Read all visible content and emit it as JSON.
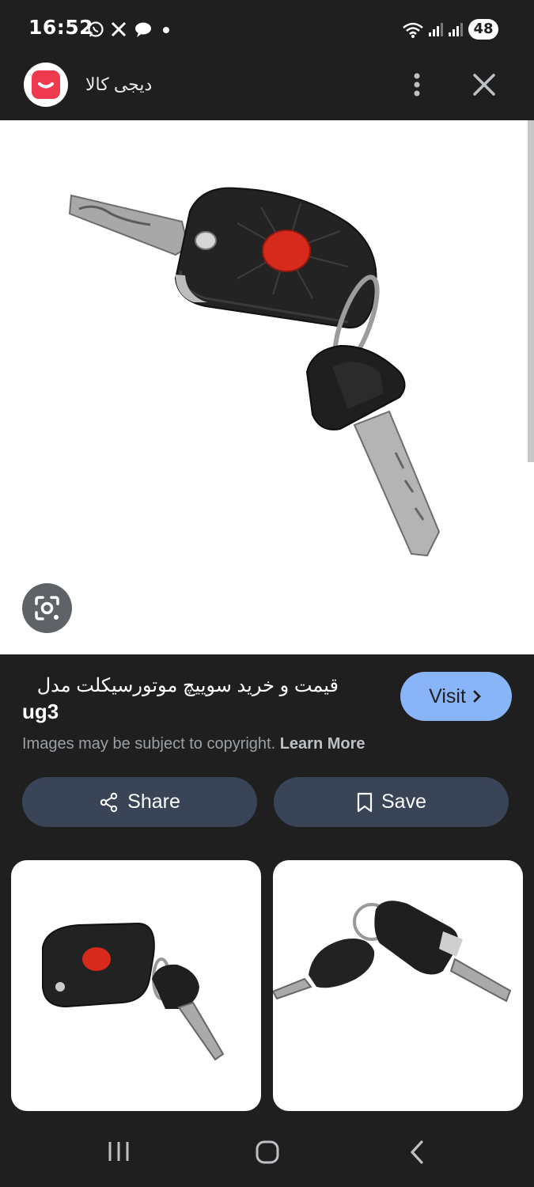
{
  "status_bar": {
    "time": "16:52",
    "battery": "48",
    "icons": [
      "whatsapp-icon",
      "x-icon",
      "chat-icon",
      "dot-icon",
      "wifi-icon",
      "signal-icon",
      "signal-icon"
    ]
  },
  "header": {
    "site_name": "دیجی کالا",
    "logo_color": "#ef394e"
  },
  "details": {
    "title_rtl": "قیمت و خرید سوییچ موتورسیکلت مدل",
    "title_ltr": "ug3",
    "visit_label": "Visit",
    "copyright_text": "Images may be subject to copyright.",
    "learn_more": "Learn More"
  },
  "actions": {
    "share_label": "Share",
    "save_label": "Save"
  },
  "colors": {
    "accent": "#8ab4f8",
    "pill_bg": "#394457",
    "background": "#1f1f1f"
  }
}
